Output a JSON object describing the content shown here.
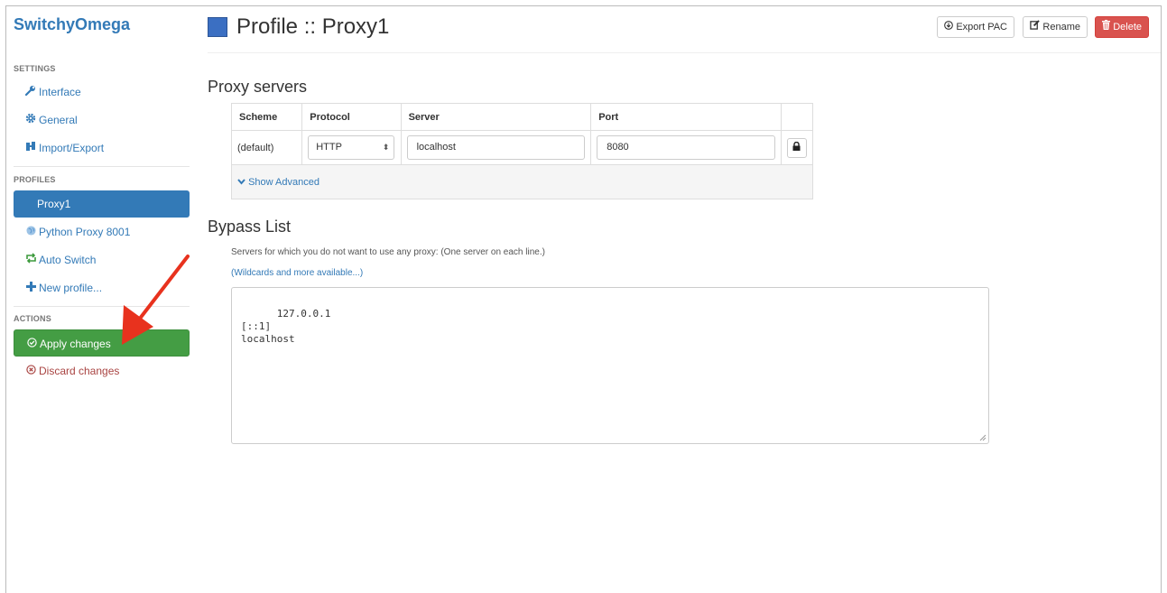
{
  "app": {
    "brand": "SwitchyOmega"
  },
  "sidebar": {
    "settings_header": "SETTINGS",
    "settings": [
      {
        "label": "Interface",
        "icon": "wrench-icon"
      },
      {
        "label": "General",
        "icon": "gear-icon"
      },
      {
        "label": "Import/Export",
        "icon": "import-export-icon"
      }
    ],
    "profiles_header": "PROFILES",
    "profiles": [
      {
        "label": "Proxy1",
        "active": true
      },
      {
        "label": "Python Proxy 8001",
        "icon": "globe-icon"
      },
      {
        "label": "Auto Switch",
        "icon": "switch-arrows-icon"
      },
      {
        "label": "New profile...",
        "icon": "plus-icon"
      }
    ],
    "actions_header": "ACTIONS",
    "apply_label": "Apply changes",
    "discard_label": "Discard changes"
  },
  "header": {
    "title": "Profile :: Proxy1",
    "profile_color": "#3b6fc2",
    "export_label": "Export PAC",
    "rename_label": "Rename",
    "delete_label": "Delete"
  },
  "proxy_servers": {
    "heading": "Proxy servers",
    "columns": [
      "Scheme",
      "Protocol",
      "Server",
      "Port"
    ],
    "row": {
      "scheme": "(default)",
      "protocol": "HTTP",
      "server": "localhost",
      "port": "8080"
    },
    "show_advanced": "Show Advanced"
  },
  "bypass": {
    "heading": "Bypass List",
    "help": "Servers for which you do not want to use any proxy: (One server on each line.)",
    "link": "(Wildcards and more available...)",
    "content": "127.0.0.1\n[::1]\nlocalhost"
  },
  "colors": {
    "accent": "#337ab7",
    "apply": "#449d44",
    "danger": "#d9534f",
    "discard": "#a94442",
    "arrow": "#e8321e"
  }
}
